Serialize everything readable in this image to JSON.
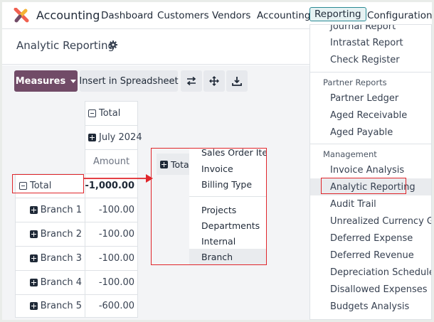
{
  "navbar": {
    "app_name": "Accounting",
    "menu": [
      "Dashboard",
      "Customers",
      "Vendors",
      "Accounting",
      "Reporting",
      "Configuration"
    ]
  },
  "control_panel": {
    "title": "Analytic Reporting"
  },
  "toolbar": {
    "measures_label": "Measures",
    "insert_label": "Insert in Spreadsheet"
  },
  "pivot": {
    "col_total": "Total",
    "col_group": "July 2024",
    "measure": "Amount",
    "row_total_label": "Total",
    "row_total_value": "-1,000.00",
    "rows": [
      {
        "label": "Branch 1",
        "value": "-100.00"
      },
      {
        "label": "Branch 2",
        "value": "-100.00"
      },
      {
        "label": "Branch 3",
        "value": "-100.00"
      },
      {
        "label": "Branch 4",
        "value": "-100.00"
      },
      {
        "label": "Branch 5",
        "value": "-600.00"
      }
    ]
  },
  "groupby_popup": {
    "chip_label": "Total",
    "items_a": [
      "Sales Order Item",
      "Invoice",
      "Billing Type"
    ],
    "items_b": [
      "Projects",
      "Departments",
      "Internal",
      "Branch"
    ]
  },
  "reporting_menu": {
    "partial_top": "Journal Report",
    "items_top": [
      "Intrastat Report",
      "Check Register"
    ],
    "partner_header": "Partner Reports",
    "partner_items": [
      "Partner Ledger",
      "Aged Receivable",
      "Aged Payable"
    ],
    "management_header": "Management",
    "management_items": [
      "Invoice Analysis",
      "Analytic Reporting",
      "Audit Trail",
      "Unrealized Currency Gains",
      "Deferred Expense",
      "Deferred Revenue",
      "Depreciation Schedule",
      "Disallowed Expenses",
      "Budgets Analysis"
    ]
  },
  "colors": {
    "primary": "#714b67",
    "annotation": "#e0262b"
  }
}
